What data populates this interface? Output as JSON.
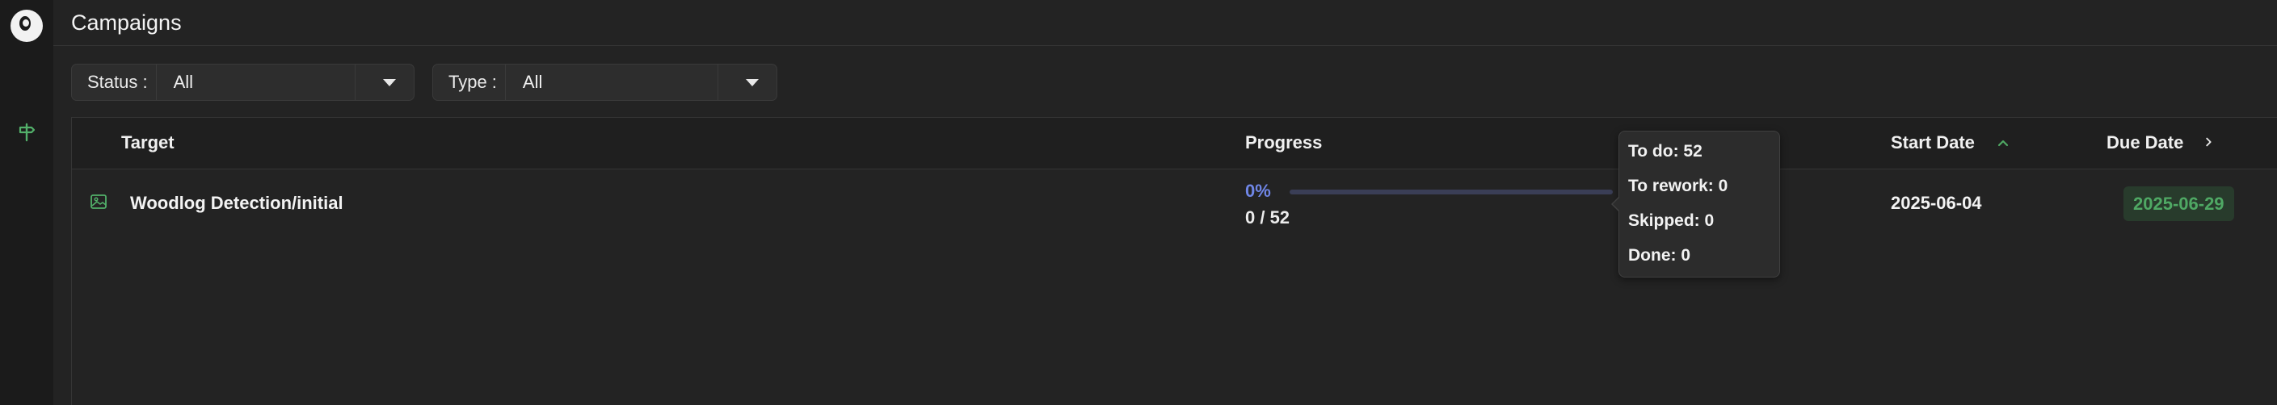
{
  "page": {
    "title": "Campaigns"
  },
  "filters": [
    {
      "label": "Status :",
      "value": "All"
    },
    {
      "label": "Type :",
      "value": "All"
    }
  ],
  "table": {
    "columns": {
      "target": "Target",
      "progress": "Progress",
      "start_date": "Start Date",
      "due_date": "Due Date"
    },
    "sort": {
      "column": "Start Date",
      "direction": "ascending"
    },
    "rows": [
      {
        "target": "Woodlog Detection/initial",
        "target_icon": "image-icon",
        "progress_percent_text": "0%",
        "progress_fraction": 0,
        "progress_count": "0 / 52",
        "start_date": "2025-06-04",
        "due_date": "2025-06-29"
      }
    ]
  },
  "tooltip": {
    "lines": [
      "To do: 52",
      "To rework: 0",
      "Skipped: 0",
      "Done: 0"
    ]
  },
  "colors": {
    "accent": "#6f86e6",
    "due_text": "#4fa864",
    "due_bg": "#283b2c",
    "sort_icon": "#4fa864"
  },
  "icons": {
    "logo": "app-logo",
    "nav": "signpost-icon",
    "sort_up": "chevron-up-icon",
    "next": "chevron-right-icon",
    "dropdown": "caret-down-icon"
  }
}
